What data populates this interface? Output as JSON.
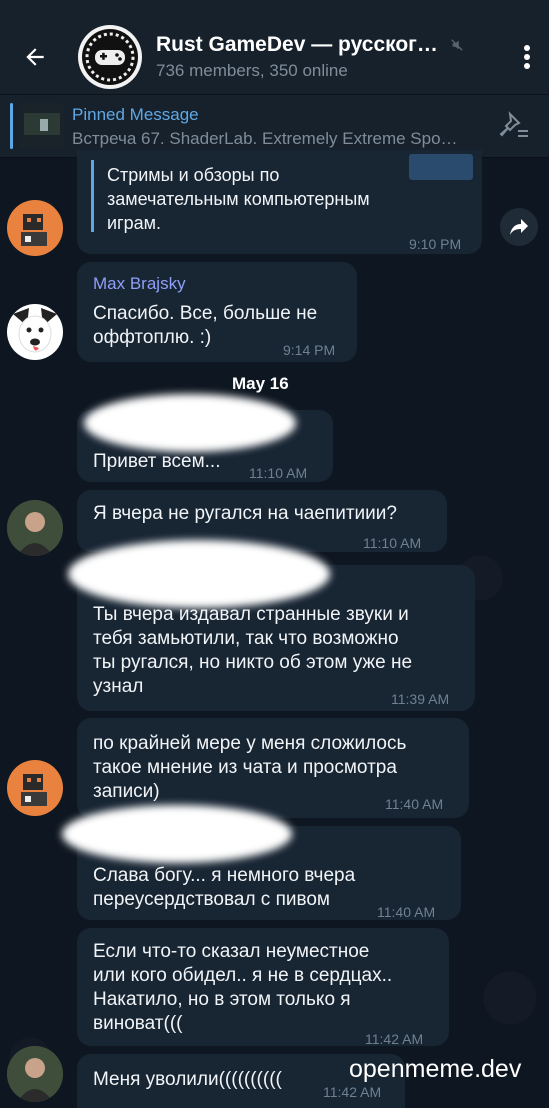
{
  "header": {
    "title": "Rust GameDev — русског…",
    "subtitle": "736 members, 350 online"
  },
  "pinned": {
    "title": "Pinned Message",
    "text": "Встреча 67. ShaderLab. Extremely Extreme Spo…"
  },
  "messages": [
    {
      "text": "Стримы и обзоры по\nзамечательным компьютерным\nиграм.",
      "time": "9:10 PM"
    },
    {
      "sender": "Max Brajsky",
      "text": "Спасибо. Все, больше не\nоффтоплю. :)",
      "time": "9:14 PM"
    },
    {
      "text": "Привет всем...",
      "time": "11:10 AM"
    },
    {
      "text": "Я вчера не ругался на чаепитиии?",
      "time": "11:10 AM"
    },
    {
      "text": "Ты вчера издавал странные звуки и\nтебя замьютили, так что возможно\nты ругался, но никто об этом уже не\nузнал",
      "time": "11:39 AM"
    },
    {
      "text": "по крайней мере у меня сложилось\nтакое мнение из чата и просмотра\nзаписи)",
      "time": "11:40 AM"
    },
    {
      "text": "Слава богу... я немного вчера\nпереусердствовал с пивом",
      "time": "11:40 AM"
    },
    {
      "text": "Если что-то сказал неуместное\nили кого обидел.. я не в сердцах..\nНакатило, но в этом только я\nвиноват(((",
      "time": "11:42 AM"
    },
    {
      "text": "Меня уволили((((((((((",
      "time": "11:42 AM"
    }
  ],
  "date_separator": "May 16",
  "watermark": "openmeme.dev",
  "colors": {
    "background": "#0e1621",
    "bubble": "#182533",
    "accent": "#5fa8e6",
    "sender": "#8f9ff8"
  },
  "icons": [
    "back-arrow-icon",
    "mute-icon",
    "more-vert-icon",
    "unpin-icon",
    "forward-icon"
  ]
}
